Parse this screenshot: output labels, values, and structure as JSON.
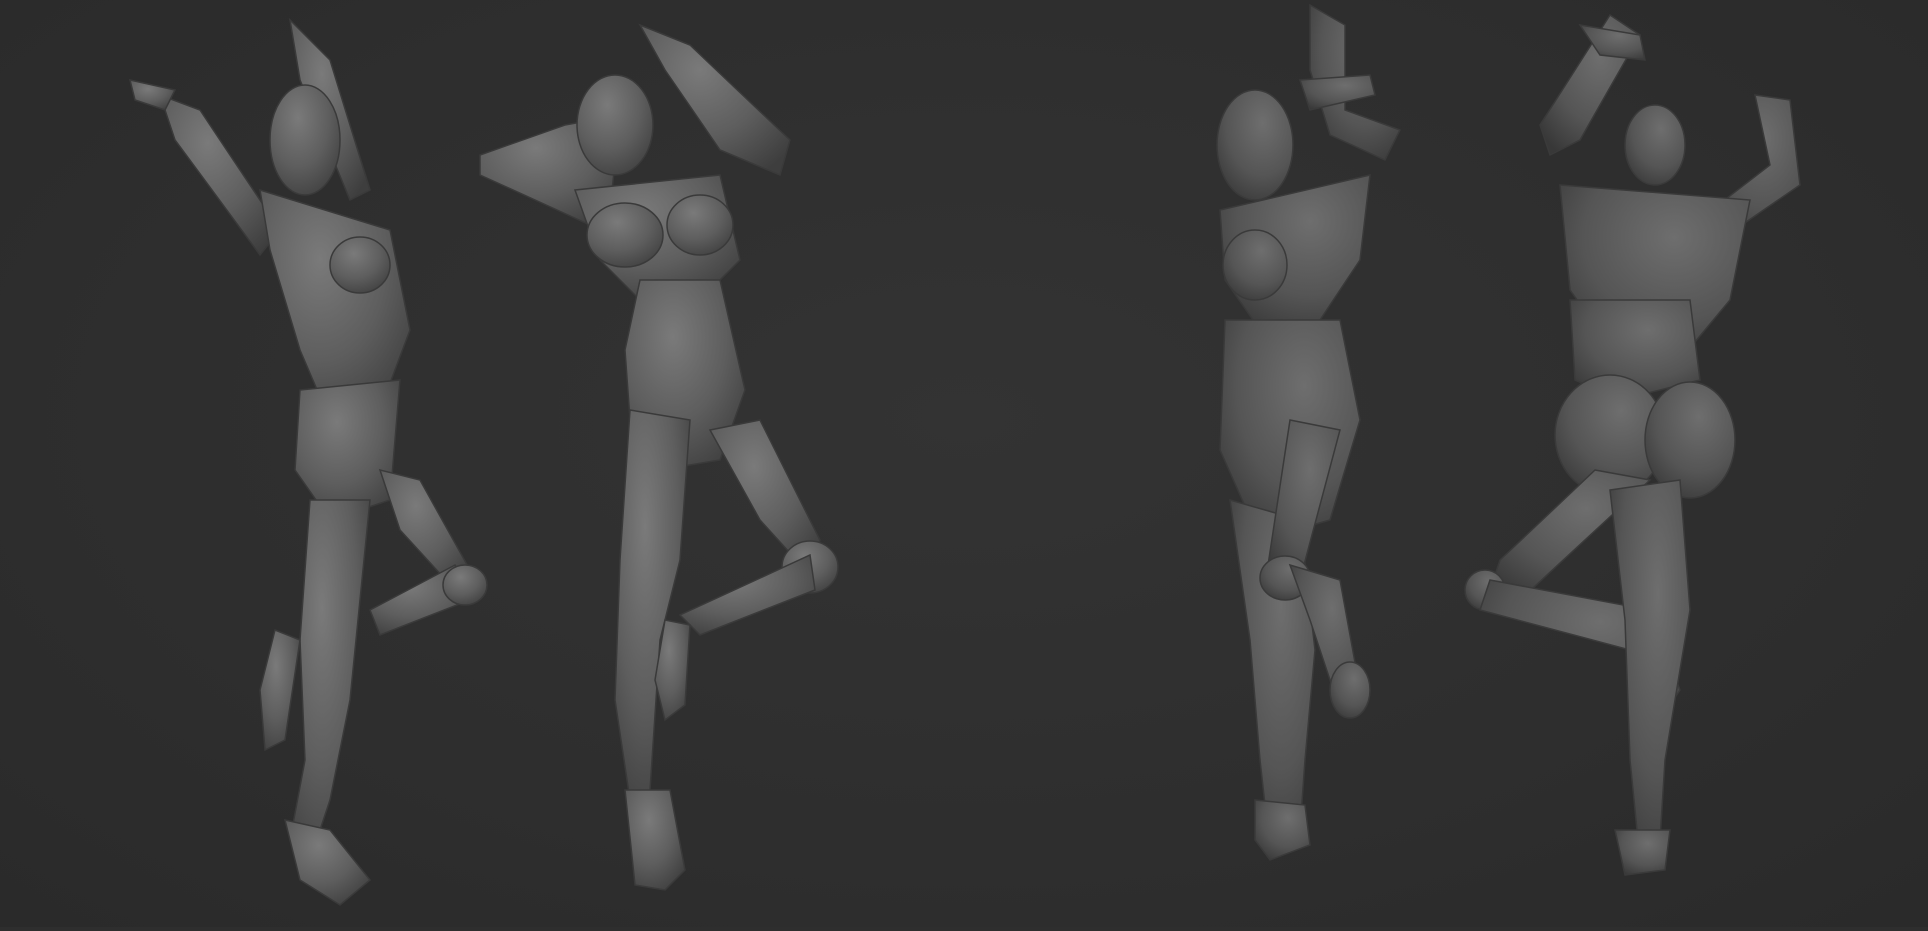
{
  "scene": {
    "background_color": "#2e2e2e",
    "material_color": "#6a6a6a",
    "views": [
      {
        "name": "three-quarter-front-left"
      },
      {
        "name": "front"
      },
      {
        "name": "three-quarter-front-right"
      },
      {
        "name": "back"
      }
    ]
  }
}
